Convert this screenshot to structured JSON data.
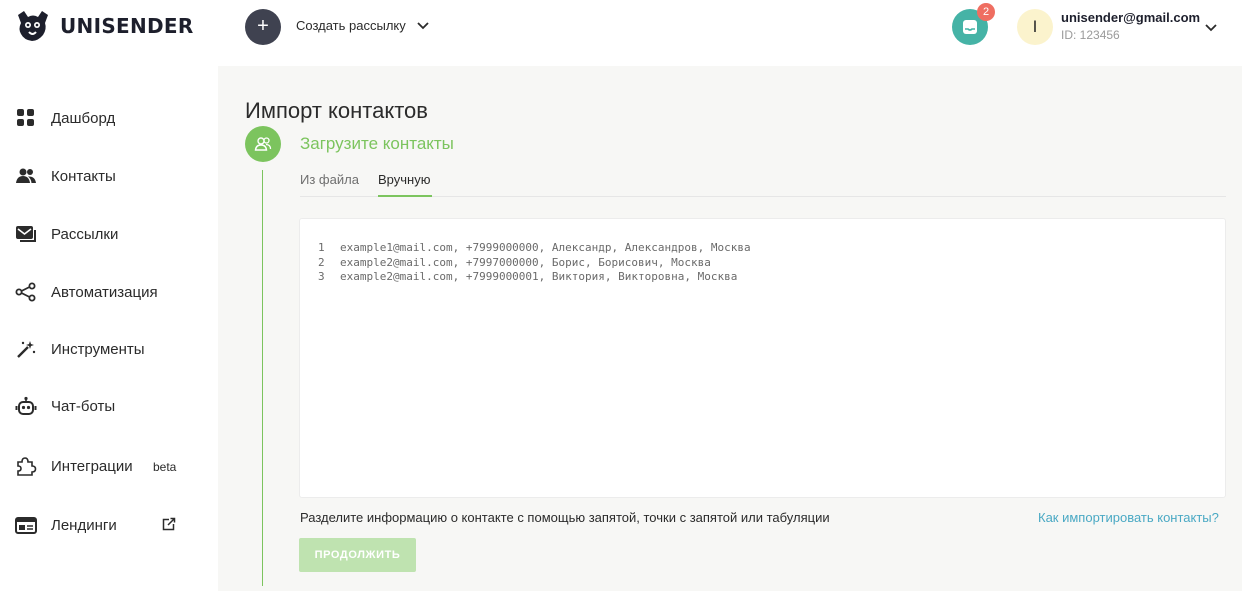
{
  "header": {
    "logo_text": "UNISENDER",
    "create_button_icon": "+",
    "create_label": "Создать рассылку",
    "notifications_count": "2",
    "avatar_letter": "I",
    "user_email": "unisender@gmail.com",
    "user_id": "ID: 123456"
  },
  "sidebar": {
    "items": [
      {
        "label": "Дашборд",
        "icon": "dashboard-icon"
      },
      {
        "label": "Контакты",
        "icon": "contacts-icon"
      },
      {
        "label": "Рассылки",
        "icon": "mailing-icon"
      },
      {
        "label": "Автоматизация",
        "icon": "automation-icon"
      },
      {
        "label": "Инструменты",
        "icon": "magic-wand-icon"
      },
      {
        "label": "Чат-боты",
        "icon": "robot-icon"
      },
      {
        "label": "Интеграции",
        "icon": "puzzle-icon",
        "badge": "beta"
      },
      {
        "label": "Лендинги",
        "icon": "landing-icon"
      }
    ]
  },
  "main": {
    "page_title": "Импорт контактов",
    "step_title": "Загрузите контакты",
    "tabs": [
      {
        "label": "Из файла",
        "active": false
      },
      {
        "label": "Вручную",
        "active": true
      }
    ],
    "editor_lines": [
      {
        "num": "1",
        "text": "example1@mail.com, +7999000000, Александр, Александров, Москва"
      },
      {
        "num": "2",
        "text": "example2@mail.com, +7997000000, Борис, Борисович, Москва"
      },
      {
        "num": "3",
        "text": "example2@mail.com, +7999000001, Виктория, Викторовна, Москва"
      }
    ],
    "hint": "Разделите информацию о контакте с помощью запятой, точки с запятой или табуляции",
    "help_link": "Как импортировать контакты?",
    "continue_label": "ПРОДОЛЖИТЬ"
  },
  "colors": {
    "accent_green": "#7cc45e",
    "notification_teal": "#45b3a6",
    "badge_red": "#ef6e61",
    "link_blue": "#4aa9c4"
  }
}
